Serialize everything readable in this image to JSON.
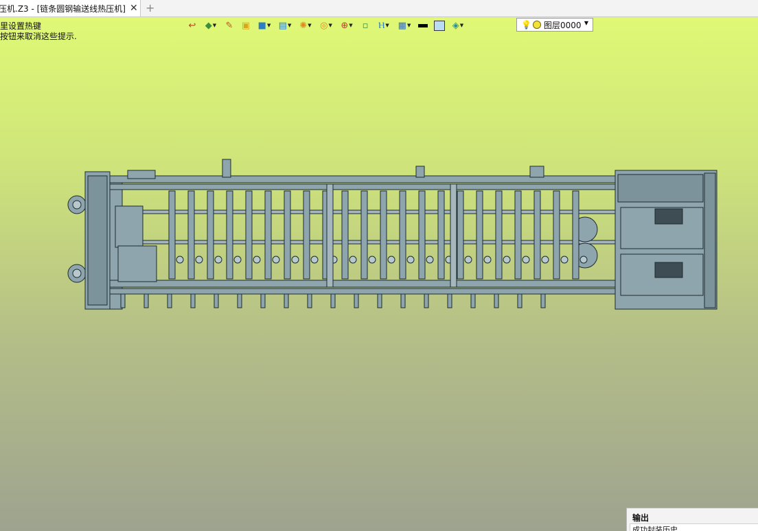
{
  "tab": {
    "title": "压机.Z3 - [链条圆钢输送线热压机]",
    "close": "✕",
    "add": "+"
  },
  "hints": [
    "里设置热键",
    "按钮来取消这些提示."
  ],
  "toolbar": {
    "layer_value": "图层0000",
    "buttons": [
      {
        "icon": "exit-icon",
        "glyph": "↩"
      },
      {
        "icon": "shape-layers-icon",
        "glyph": "◆"
      },
      {
        "icon": "brush-icon",
        "glyph": "✎"
      },
      {
        "icon": "box-yellow-icon",
        "glyph": "▣"
      },
      {
        "icon": "cube-blue-icon",
        "glyph": "■"
      },
      {
        "icon": "views-icon",
        "glyph": "▤"
      },
      {
        "icon": "sphere-orange-icon",
        "glyph": "✺"
      },
      {
        "icon": "target-circle-icon",
        "glyph": "◎"
      },
      {
        "icon": "snap-point-icon",
        "glyph": "⊕"
      },
      {
        "icon": "fit-view-icon",
        "glyph": "▫"
      },
      {
        "icon": "dimension-icon",
        "glyph": "Ⲏ"
      },
      {
        "icon": "display-mode-icon",
        "glyph": "▦"
      }
    ]
  },
  "colors": {
    "bg_top": "#e1fb75",
    "bg_bottom": "#9ea38f",
    "model_fill": "#8fa5ad",
    "model_stroke": "#1b2a30"
  },
  "output": {
    "title": "输出",
    "text": "成功封装历史"
  }
}
